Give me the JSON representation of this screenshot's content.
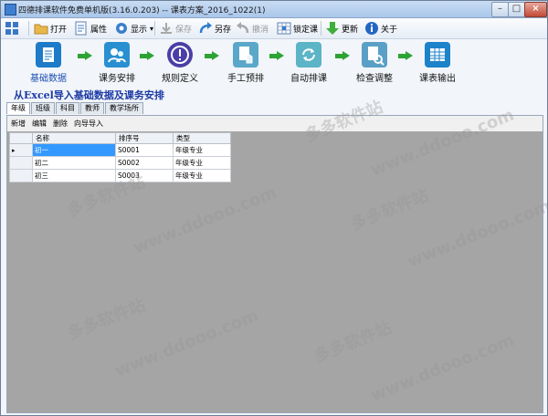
{
  "window": {
    "title": "四德排课软件免费单机版(3.16.0.203) -- 课表方案_2016_1022(1)",
    "minimize": "–",
    "maximize": "□",
    "close": "×"
  },
  "toolbar": {
    "open": "打开",
    "properties": "属性",
    "display": "显示",
    "display_arrow": "▾",
    "save": "保存",
    "save_as": "另存",
    "undo": "撤消",
    "lock": "锁定课",
    "update": "更新",
    "about": "关于"
  },
  "flow": {
    "steps": [
      {
        "label": "基础数据",
        "color": "#1e7bc8"
      },
      {
        "label": "课务安排",
        "color": "#2a8fd0"
      },
      {
        "label": "规则定义",
        "color": "#4b3ea6"
      },
      {
        "label": "手工预排",
        "color": "#5aa7c9"
      },
      {
        "label": "自动排课",
        "color": "#5cb4c7"
      },
      {
        "label": "检查调整",
        "color": "#5aa0c6"
      },
      {
        "label": "课表输出",
        "color": "#1c82c9"
      }
    ],
    "arrow_color": "#2da335"
  },
  "import_title": "从Excel导入基础数据及课务安排",
  "tabs": [
    "年级",
    "班级",
    "科目",
    "教师",
    "教学场所"
  ],
  "subbar": {
    "add": "新增",
    "edit": "编辑",
    "delete": "删除",
    "wizard": "向导导入"
  },
  "grid": {
    "columns": [
      "名称",
      "排序号",
      "类型"
    ],
    "rows": [
      [
        "初一",
        "S0001",
        "年级专业"
      ],
      [
        "初二",
        "S0002",
        "年级专业"
      ],
      [
        "初三",
        "S0003",
        "年级专业"
      ]
    ],
    "current_row_marker": "▸"
  },
  "watermarks": [
    "多多软件站",
    "www.ddooo.com"
  ],
  "colors": {
    "selected": "#3399ff",
    "grid_background": "#a5a5a5",
    "title_blue": "#1c3aa6"
  }
}
